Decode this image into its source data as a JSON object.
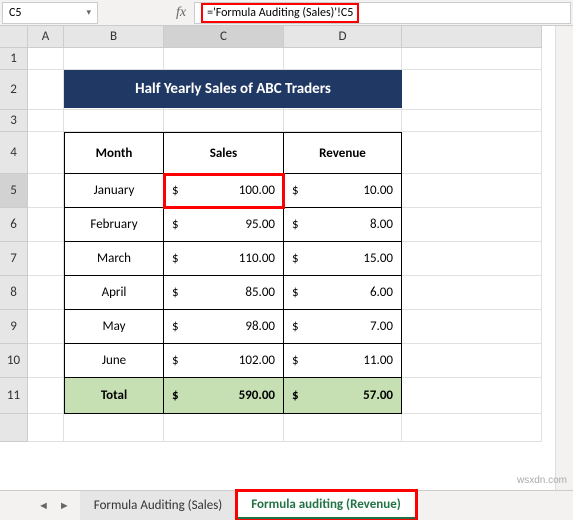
{
  "namebox": "C5",
  "formula": "='Formula Auditing (Sales)'!C5",
  "columns": [
    "A",
    "B",
    "C",
    "D"
  ],
  "rows": [
    "1",
    "2",
    "3",
    "4",
    "5",
    "6",
    "7",
    "8",
    "9",
    "10",
    "11"
  ],
  "title": "Half Yearly Sales of ABC Traders",
  "headers": {
    "month": "Month",
    "sales": "Sales",
    "revenue": "Revenue"
  },
  "total_label": "Total",
  "currency": "$",
  "data": [
    {
      "month": "January",
      "sales": "100.00",
      "revenue": "10.00"
    },
    {
      "month": "February",
      "sales": "95.00",
      "revenue": "8.00"
    },
    {
      "month": "March",
      "sales": "110.00",
      "revenue": "15.00"
    },
    {
      "month": "April",
      "sales": "85.00",
      "revenue": "6.00"
    },
    {
      "month": "May",
      "sales": "98.00",
      "revenue": "7.00"
    },
    {
      "month": "June",
      "sales": "102.00",
      "revenue": "11.00"
    }
  ],
  "totals": {
    "sales": "590.00",
    "revenue": "57.00"
  },
  "tabs": {
    "inactive": "Formula Auditing (Sales)",
    "active": "Formula auditing (Revenue)"
  },
  "watermark": "wsxdn.com",
  "chart_data": {
    "type": "table",
    "title": "Half Yearly Sales of ABC Traders",
    "columns": [
      "Month",
      "Sales",
      "Revenue"
    ],
    "rows": [
      [
        "January",
        100.0,
        10.0
      ],
      [
        "February",
        95.0,
        8.0
      ],
      [
        "March",
        110.0,
        15.0
      ],
      [
        "April",
        85.0,
        6.0
      ],
      [
        "May",
        98.0,
        7.0
      ],
      [
        "June",
        102.0,
        11.0
      ],
      [
        "Total",
        590.0,
        57.0
      ]
    ]
  }
}
